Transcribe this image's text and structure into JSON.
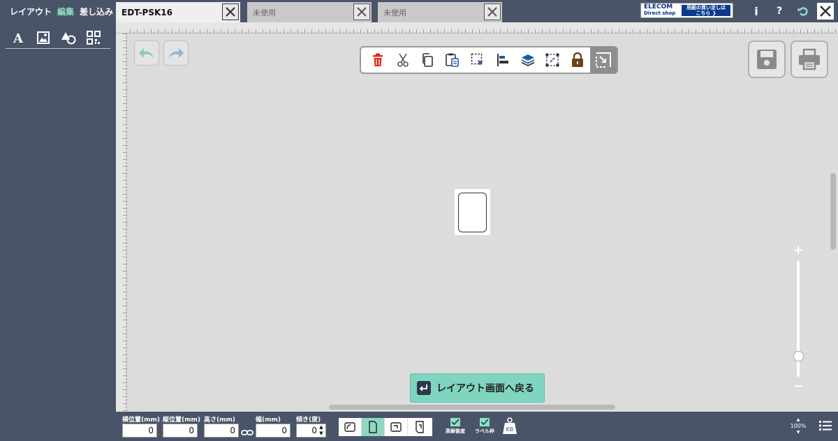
{
  "menu": {
    "items": [
      "レイアウト",
      "編集",
      "差し込み"
    ],
    "active": "編集"
  },
  "tabs": [
    {
      "label": "EDT-PSK16",
      "active": true
    },
    {
      "label": "未使用",
      "active": false
    },
    {
      "label": "未使用",
      "active": false
    }
  ],
  "banner": {
    "brand": "ELECOM",
    "sub": "Direct shop",
    "cta_line1": "用紙の買い足しは",
    "cta_line2": "こちら"
  },
  "top_icons": {
    "info": "i",
    "help": "?"
  },
  "left_tools": [
    "text-icon",
    "image-icon",
    "shapes-icon",
    "qr-code-icon"
  ],
  "edit_toolbar": [
    "trash-icon",
    "scissors-icon",
    "copy-icon",
    "paste-icon",
    "select-area-icon",
    "align-icon",
    "layers-icon",
    "group-icon",
    "lock-icon",
    "transform-icon"
  ],
  "back_button": {
    "label": "レイアウト画面へ戻る"
  },
  "fields": {
    "x": {
      "label": "横位置(mm)",
      "value": "0"
    },
    "y": {
      "label": "縦位置(mm)",
      "value": "0"
    },
    "height": {
      "label": "高さ(mm)",
      "value": "0"
    },
    "width": {
      "label": "幅(mm)",
      "value": "0"
    },
    "angle": {
      "label": "傾き(度)",
      "value": "0"
    }
  },
  "checks": {
    "hires": "高解像度",
    "frame": "ラベル枠",
    "kb": "KB"
  },
  "zoom": {
    "level": "100%",
    "slider_fraction": 0.18
  },
  "colors": {
    "accent": "#8fe0c9",
    "panel": "#4a5468",
    "canvas": "#dcdcdc",
    "delete": "#e0281e",
    "lock": "#6b4516",
    "layers": "#1f5aa8"
  }
}
